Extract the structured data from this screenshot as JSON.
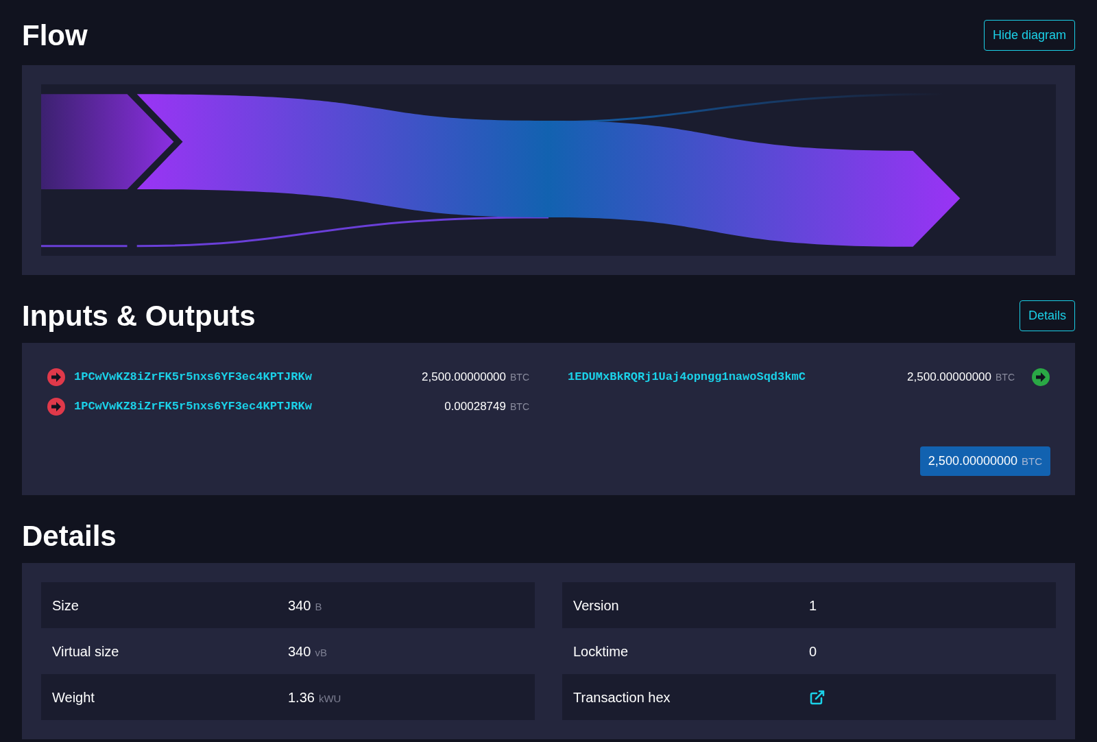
{
  "flow": {
    "title": "Flow",
    "toggle_button": "Hide diagram"
  },
  "io": {
    "title": "Inputs & Outputs",
    "details_button": "Details",
    "inputs": [
      {
        "address": "1PCwVwKZ8iZrFK5r5nxs6YF3ec4KPTJRKw",
        "amount": "2,500.00000000",
        "unit": "BTC"
      },
      {
        "address": "1PCwVwKZ8iZrFK5r5nxs6YF3ec4KPTJRKw",
        "amount": "0.00028749",
        "unit": "BTC"
      }
    ],
    "outputs": [
      {
        "address": "1EDUMxBkRQRj1Uaj4opngg1nawoSqd3kmC",
        "amount": "2,500.00000000",
        "unit": "BTC"
      }
    ],
    "total": {
      "amount": "2,500.00000000",
      "unit": "BTC"
    }
  },
  "details": {
    "title": "Details",
    "columns": [
      [
        {
          "kind": "text",
          "label": "Size",
          "value": "340",
          "unit": "B"
        },
        {
          "kind": "text",
          "label": "Virtual size",
          "value": "340",
          "unit": "vB"
        },
        {
          "kind": "text",
          "label": "Weight",
          "value": "1.36",
          "unit": "kWU"
        }
      ],
      [
        {
          "kind": "text",
          "label": "Version",
          "value": "1"
        },
        {
          "kind": "text",
          "label": "Locktime",
          "value": "0"
        },
        {
          "kind": "link",
          "label": "Transaction hex"
        }
      ]
    ]
  }
}
